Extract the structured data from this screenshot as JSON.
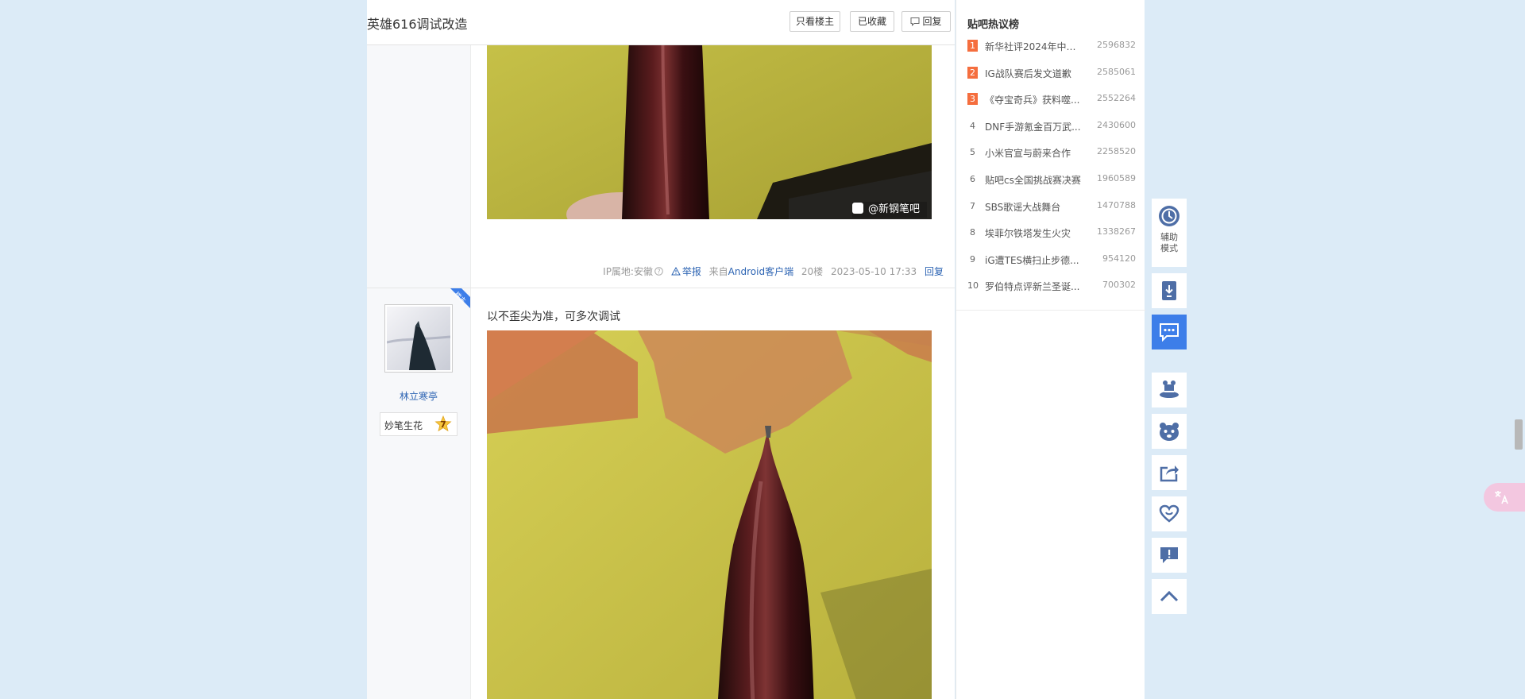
{
  "thread": {
    "title": "英雄616调试改造",
    "only_op_label": "只看楼主",
    "favorited_label": "已收藏",
    "reply_label": "回复"
  },
  "post1": {
    "watermark": "@新钢笔吧",
    "meta": {
      "ip": "IP属地:安徽",
      "report": "举报",
      "source_prefix": "来自",
      "source_client": "Android客户端",
      "floor": "20楼",
      "time": "2023-05-10 17:33",
      "reply": "回复"
    }
  },
  "post2": {
    "corner_tag": "楼主",
    "text": "以不歪尖为准，可多次调试",
    "username": "林立寒亭",
    "badge_name": "妙笔生花",
    "badge_level": "7"
  },
  "sidebar": {
    "title": "贴吧热议榜",
    "items": [
      {
        "rank": "1",
        "text": "新华社评2024年中国...",
        "count": "2596832"
      },
      {
        "rank": "2",
        "text": "IG战队赛后发文道歉",
        "count": "2585061"
      },
      {
        "rank": "3",
        "text": "《夺宝奇兵》获料噬...",
        "count": "2552264"
      },
      {
        "rank": "4",
        "text": "DNF手游氪金百万武...",
        "count": "2430600"
      },
      {
        "rank": "5",
        "text": "小米官宣与蔚来合作",
        "count": "2258520"
      },
      {
        "rank": "6",
        "text": "贴吧cs全国挑战赛决赛",
        "count": "1960589"
      },
      {
        "rank": "7",
        "text": "SBS歌谣大战舞台",
        "count": "1470788"
      },
      {
        "rank": "8",
        "text": "埃菲尔铁塔发生火灾",
        "count": "1338267"
      },
      {
        "rank": "9",
        "text": "iG遭TES横扫止步德...",
        "count": "954120"
      },
      {
        "rank": "10",
        "text": "罗伯特点评新兰圣诞...",
        "count": "700302"
      }
    ]
  },
  "toolbar": {
    "assist_mode_label": "辅助模式"
  },
  "colors": {
    "background": "#dcebf7",
    "link": "#2d64b3",
    "accent": "#3d7ee9",
    "hot_rank": "#f56e3e"
  }
}
